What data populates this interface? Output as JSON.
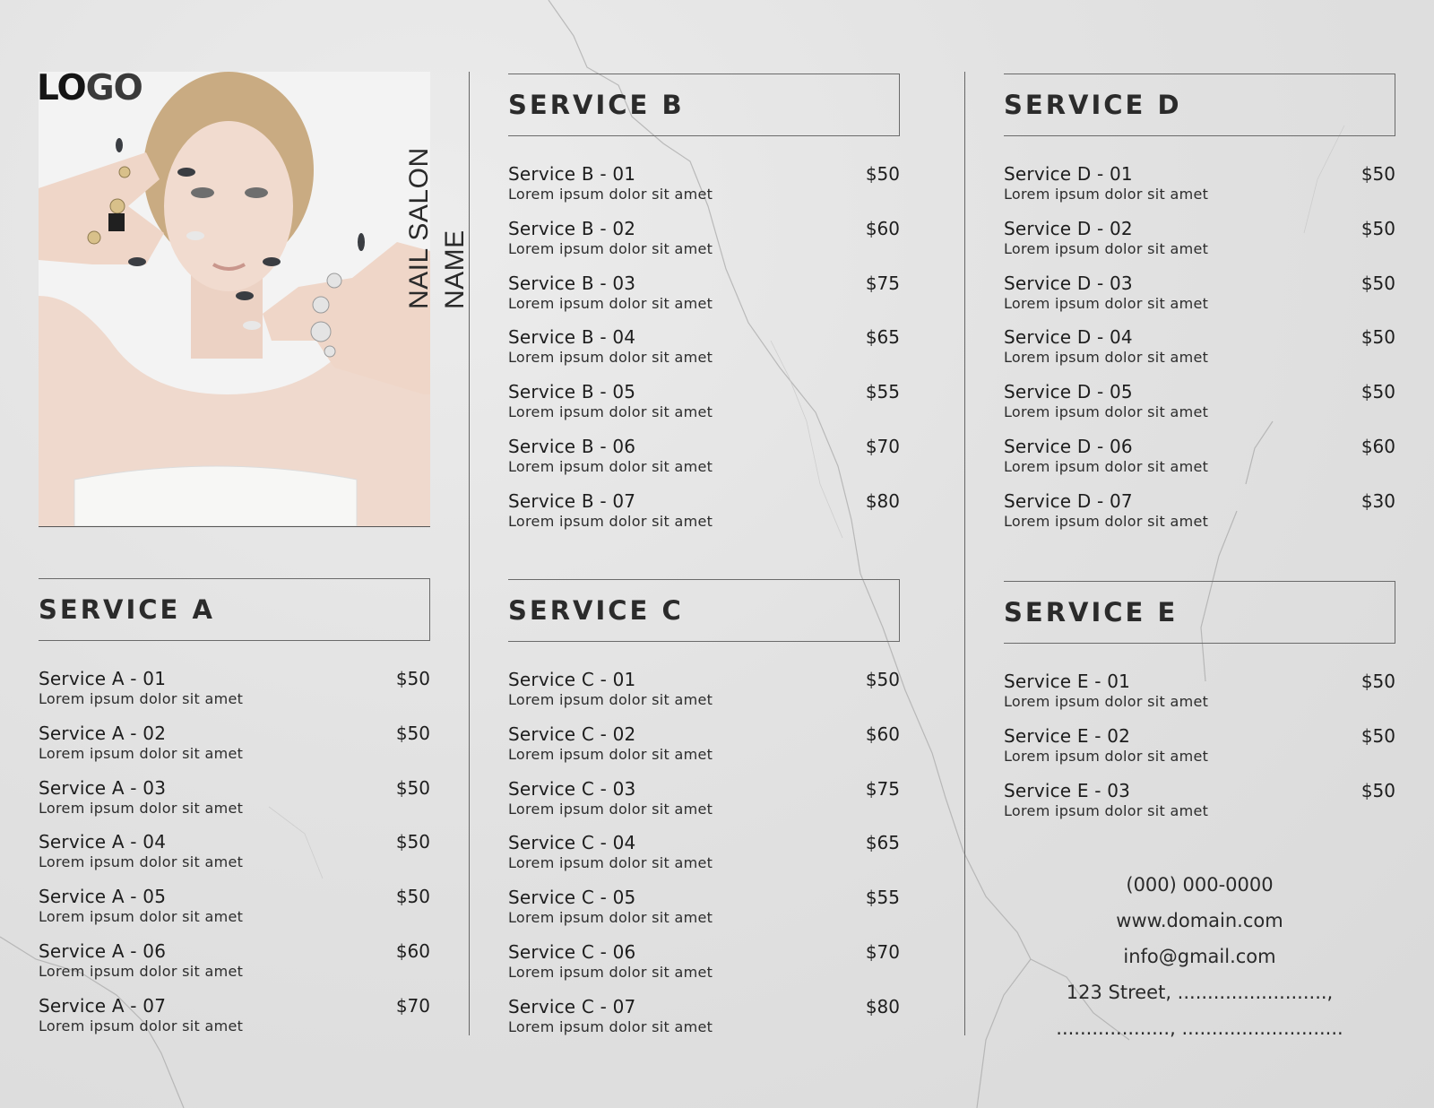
{
  "brand": {
    "logo_main": "LO",
    "logo_accent": "GO",
    "salon_name": "NAIL SALON NAME"
  },
  "sections": {
    "a": {
      "title": "SERVICE A",
      "items": [
        {
          "name": "Service A - 01",
          "desc": "Lorem ipsum dolor sit amet",
          "price": "$50"
        },
        {
          "name": "Service A - 02",
          "desc": "Lorem ipsum dolor sit amet",
          "price": "$50"
        },
        {
          "name": "Service A - 03",
          "desc": "Lorem ipsum dolor sit amet",
          "price": "$50"
        },
        {
          "name": "Service A - 04",
          "desc": "Lorem ipsum dolor sit amet",
          "price": "$50"
        },
        {
          "name": "Service A - 05",
          "desc": "Lorem ipsum dolor sit amet",
          "price": "$50"
        },
        {
          "name": "Service A - 06",
          "desc": "Lorem ipsum dolor sit amet",
          "price": "$60"
        },
        {
          "name": "Service A - 07",
          "desc": "Lorem ipsum dolor sit amet",
          "price": "$70"
        }
      ]
    },
    "b": {
      "title": "SERVICE B",
      "items": [
        {
          "name": "Service B - 01",
          "desc": "Lorem ipsum dolor sit amet",
          "price": "$50"
        },
        {
          "name": "Service B - 02",
          "desc": "Lorem ipsum dolor sit amet",
          "price": "$60"
        },
        {
          "name": "Service B - 03",
          "desc": "Lorem ipsum dolor sit amet",
          "price": "$75"
        },
        {
          "name": "Service B - 04",
          "desc": "Lorem ipsum dolor sit amet",
          "price": "$65"
        },
        {
          "name": "Service B - 05",
          "desc": "Lorem ipsum dolor sit amet",
          "price": "$55"
        },
        {
          "name": "Service B - 06",
          "desc": "Lorem ipsum dolor sit amet",
          "price": "$70"
        },
        {
          "name": "Service B - 07",
          "desc": "Lorem ipsum dolor sit amet",
          "price": "$80"
        }
      ]
    },
    "c": {
      "title": "SERVICE C",
      "items": [
        {
          "name": "Service C - 01",
          "desc": "Lorem ipsum dolor sit amet",
          "price": "$50"
        },
        {
          "name": "Service C - 02",
          "desc": "Lorem ipsum dolor sit amet",
          "price": "$60"
        },
        {
          "name": "Service C - 03",
          "desc": "Lorem ipsum dolor sit amet",
          "price": "$75"
        },
        {
          "name": "Service C - 04",
          "desc": "Lorem ipsum dolor sit amet",
          "price": "$65"
        },
        {
          "name": "Service C - 05",
          "desc": "Lorem ipsum dolor sit amet",
          "price": "$55"
        },
        {
          "name": "Service C - 06",
          "desc": "Lorem ipsum dolor sit amet",
          "price": "$70"
        },
        {
          "name": "Service C - 07",
          "desc": "Lorem ipsum dolor sit amet",
          "price": "$80"
        }
      ]
    },
    "d": {
      "title": "SERVICE D",
      "items": [
        {
          "name": "Service D - 01",
          "desc": "Lorem ipsum dolor sit amet",
          "price": "$50"
        },
        {
          "name": "Service D - 02",
          "desc": "Lorem ipsum dolor sit amet",
          "price": "$50"
        },
        {
          "name": "Service D - 03",
          "desc": "Lorem ipsum dolor sit amet",
          "price": "$50"
        },
        {
          "name": "Service D - 04",
          "desc": "Lorem ipsum dolor sit amet",
          "price": "$50"
        },
        {
          "name": "Service D - 05",
          "desc": "Lorem ipsum dolor sit amet",
          "price": "$50"
        },
        {
          "name": "Service D - 06",
          "desc": "Lorem ipsum dolor sit amet",
          "price": "$60"
        },
        {
          "name": "Service D - 07",
          "desc": "Lorem ipsum dolor sit amet",
          "price": "$30"
        }
      ]
    },
    "e": {
      "title": "SERVICE E",
      "items": [
        {
          "name": "Service E - 01",
          "desc": "Lorem ipsum dolor sit amet",
          "price": "$50"
        },
        {
          "name": "Service E - 02",
          "desc": "Lorem ipsum dolor sit amet",
          "price": "$50"
        },
        {
          "name": "Service E - 03",
          "desc": "Lorem ipsum dolor sit amet",
          "price": "$50"
        }
      ]
    }
  },
  "contact": {
    "phone": "(000) 000-0000",
    "website": "www.domain.com",
    "email": "info@gmail.com",
    "address_line1": "123 Street, .........................,",
    "address_line2": "..................., ..........................."
  }
}
